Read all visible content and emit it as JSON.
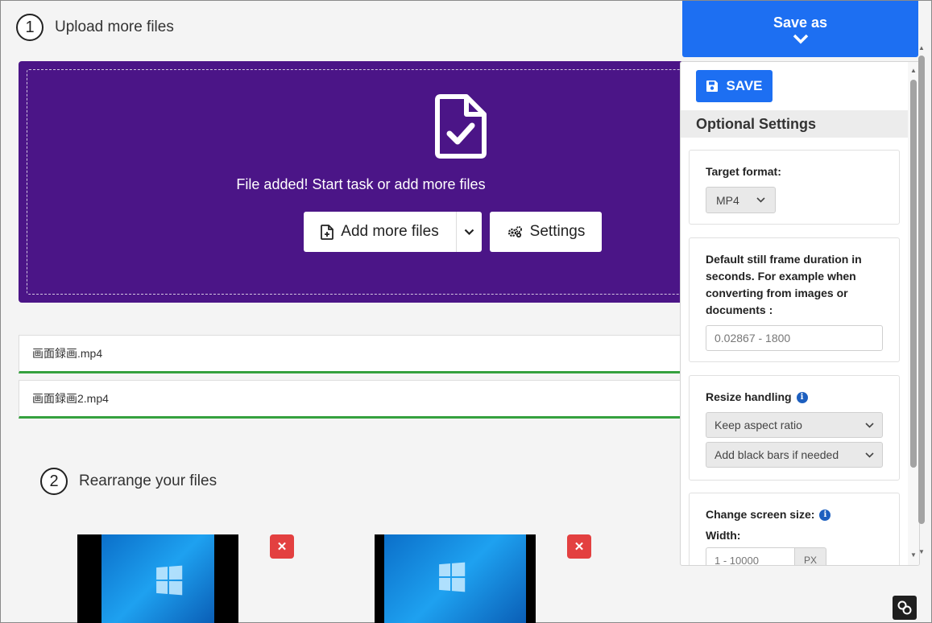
{
  "steps": {
    "step1": {
      "num": "1",
      "label": "Upload more files"
    },
    "step2": {
      "num": "2",
      "label": "Rearrange your files"
    }
  },
  "dropzone": {
    "message": "File added! Start task or add more files",
    "add_more_label": "Add more files",
    "settings_label": "Settings",
    "colors": {
      "background": "#4b1587"
    }
  },
  "files": [
    {
      "name": "画面録画.mp4",
      "progress": 100
    },
    {
      "name": "画面録画2.mp4",
      "progress": 100
    }
  ],
  "save_as": {
    "label": "Save as"
  },
  "panel": {
    "save_label": "SAVE",
    "optional_heading": "Optional Settings",
    "target_format": {
      "label": "Target format:",
      "value": "MP4"
    },
    "still_frame": {
      "label": "Default still frame duration in seconds. For example when converting from images or documents :",
      "placeholder": "0.02867 - 1800"
    },
    "resize": {
      "label": "Resize handling",
      "option1": "Keep aspect ratio",
      "option2": "Add black bars if needed"
    },
    "screen_size": {
      "label": "Change screen size:",
      "width_label": "Width:",
      "width_placeholder": "1 - 10000",
      "unit": "PX"
    }
  },
  "colors": {
    "accent": "#1d6ff2",
    "danger": "#e34040",
    "success": "#35a13e"
  }
}
